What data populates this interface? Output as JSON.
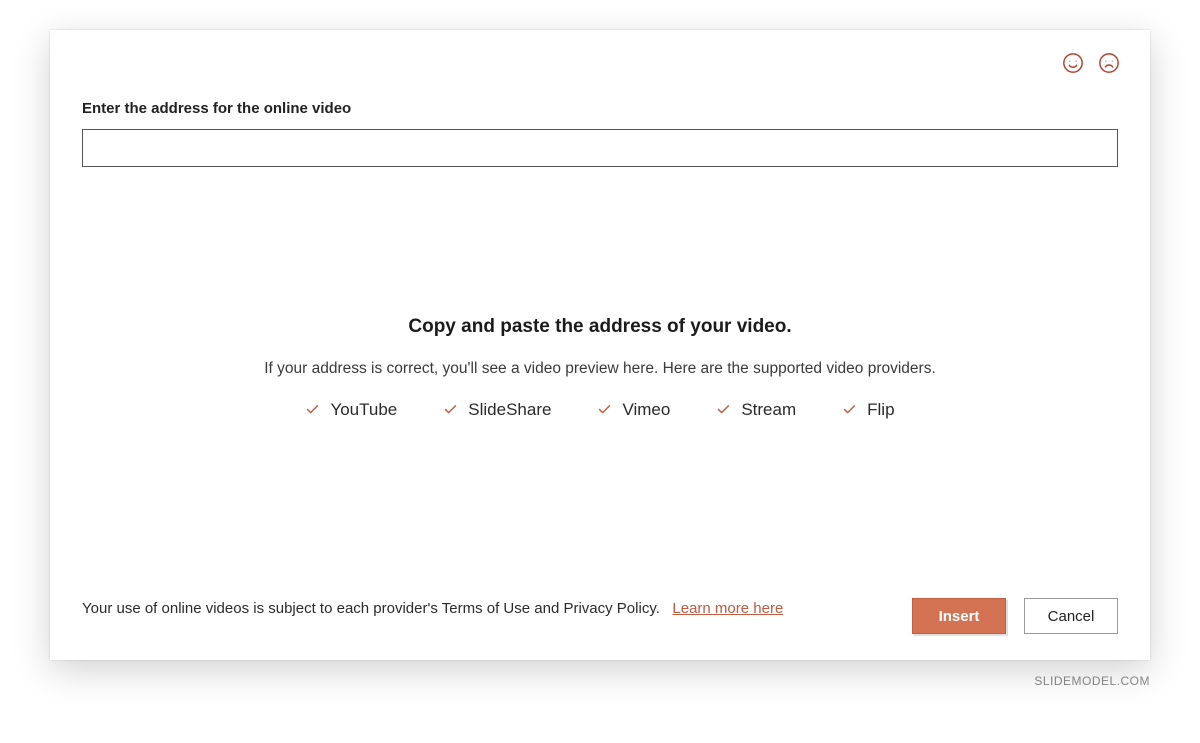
{
  "label": "Enter the address for the online video",
  "input": {
    "value": "",
    "placeholder": ""
  },
  "center": {
    "headline": "Copy and paste the address of your video.",
    "subline": "If your address is correct, you'll see a video preview here. Here are the supported video providers."
  },
  "providers": [
    "YouTube",
    "SlideShare",
    "Vimeo",
    "Stream",
    "Flip"
  ],
  "footer": {
    "terms": "Your use of online videos is subject to each provider's Terms of Use and Privacy Policy.",
    "link": "Learn more here",
    "insert": "Insert",
    "cancel": "Cancel"
  },
  "watermark": "SLIDEMODEL.COM"
}
